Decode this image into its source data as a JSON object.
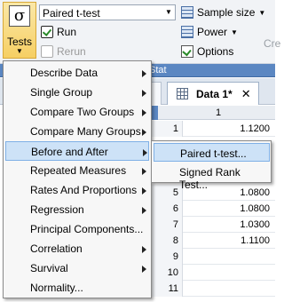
{
  "ribbon": {
    "tests_label": "Tests",
    "tests_icon": "sigma",
    "test_select_value": "Paired t-test",
    "run_label": "Run",
    "rerun_label": "Rerun",
    "sample_size_label": "Sample size",
    "power_label": "Power",
    "options_label": "Options",
    "group_partial": "Cre"
  },
  "stat_bar": {
    "label": "Stat"
  },
  "tab": {
    "label": "Data 1*",
    "close": "✕"
  },
  "grid": {
    "column_header": "1",
    "rows": [
      {
        "n": "1",
        "v": "1.1200"
      },
      {
        "n": "5",
        "v": "1.0800"
      },
      {
        "n": "6",
        "v": "1.0800"
      },
      {
        "n": "7",
        "v": "1.0300"
      },
      {
        "n": "8",
        "v": "1.1100"
      },
      {
        "n": "9",
        "v": ""
      },
      {
        "n": "10",
        "v": ""
      },
      {
        "n": "11",
        "v": ""
      }
    ]
  },
  "menu": {
    "items": [
      {
        "label": "Describe Data",
        "submenu": true
      },
      {
        "label": "Single Group",
        "submenu": true
      },
      {
        "label": "Compare Two Groups",
        "submenu": true
      },
      {
        "label": "Compare Many Groups",
        "submenu": true
      },
      {
        "label": "Before and After",
        "submenu": true,
        "highlighted": true
      },
      {
        "label": "Repeated Measures",
        "submenu": true
      },
      {
        "label": "Rates And Proportions",
        "submenu": true
      },
      {
        "label": "Regression",
        "submenu": true
      },
      {
        "label": "Principal Components...",
        "submenu": false
      },
      {
        "label": "Correlation",
        "submenu": true
      },
      {
        "label": "Survival",
        "submenu": true
      },
      {
        "label": "Normality...",
        "submenu": false
      }
    ]
  },
  "submenu": {
    "items": [
      {
        "label": "Paired t-test...",
        "highlighted": true
      },
      {
        "label": "Signed Rank Test..."
      }
    ]
  },
  "colors": {
    "highlight": "#cde2f7",
    "stat_bar": "#5b87c2",
    "tests_button": "#f6cf63"
  }
}
